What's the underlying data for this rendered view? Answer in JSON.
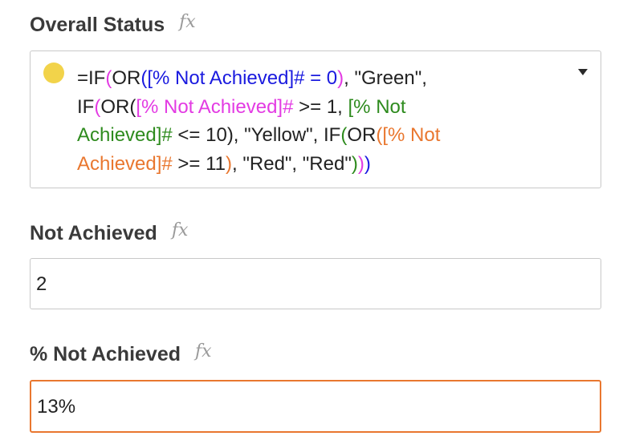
{
  "fields": {
    "overall_status": {
      "label": "Overall Status",
      "formula_icon": "fx",
      "status_color": "#f2d34a",
      "formula_tokens": [
        {
          "t": "=IF",
          "c": "black"
        },
        {
          "t": "(",
          "c": "magenta"
        },
        {
          "t": "OR",
          "c": "black"
        },
        {
          "t": "(",
          "c": "blue"
        },
        {
          "t": "[% Not Achieved]# = 0",
          "c": "blue"
        },
        {
          "t": ")",
          "c": "magenta"
        },
        {
          "t": ", \"Green\",\n",
          "c": "black"
        },
        {
          "t": "IF",
          "c": "black"
        },
        {
          "t": "(",
          "c": "magenta"
        },
        {
          "t": "OR",
          "c": "black"
        },
        {
          "t": "(",
          "c": "black"
        },
        {
          "t": "[% Not Achieved]#",
          "c": "magenta"
        },
        {
          "t": " >= 1, ",
          "c": "black"
        },
        {
          "t": "[% Not\nAchieved]#",
          "c": "green"
        },
        {
          "t": " <= 10), \"Yellow\", IF",
          "c": "black"
        },
        {
          "t": "(",
          "c": "green"
        },
        {
          "t": "OR",
          "c": "black"
        },
        {
          "t": "(",
          "c": "orange"
        },
        {
          "t": "[% Not\nAchieved]#",
          "c": "orange"
        },
        {
          "t": " >= 11",
          "c": "black"
        },
        {
          "t": ")",
          "c": "orange"
        },
        {
          "t": ", \"Red\", \"Red\"",
          "c": "black"
        },
        {
          "t": ")",
          "c": "green"
        },
        {
          "t": ")",
          "c": "magenta"
        },
        {
          "t": ")",
          "c": "blue"
        }
      ]
    },
    "not_achieved": {
      "label": "Not Achieved",
      "formula_icon": "fx",
      "value": "2"
    },
    "pct_not_achieved": {
      "label": "% Not Achieved",
      "formula_icon": "fx",
      "value": "13%"
    }
  }
}
